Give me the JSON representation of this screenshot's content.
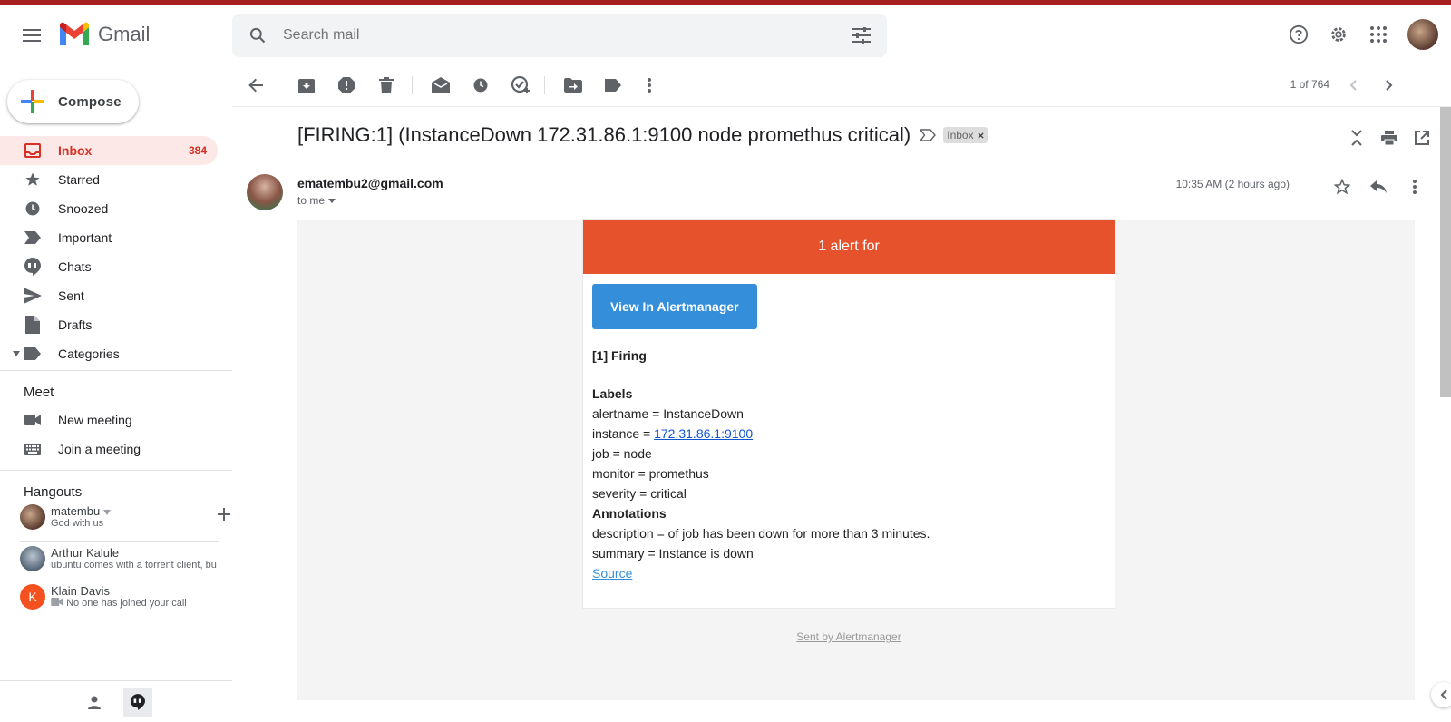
{
  "header": {
    "app_name": "Gmail",
    "search_placeholder": "Search mail"
  },
  "sidebar": {
    "compose_label": "Compose",
    "items": [
      {
        "label": "Inbox",
        "count": "384",
        "icon": "inbox-icon"
      },
      {
        "label": "Starred",
        "icon": "star-icon"
      },
      {
        "label": "Snoozed",
        "icon": "clock-icon"
      },
      {
        "label": "Important",
        "icon": "important-icon"
      },
      {
        "label": "Chats",
        "icon": "chat-icon"
      },
      {
        "label": "Sent",
        "icon": "send-icon"
      },
      {
        "label": "Drafts",
        "icon": "draft-icon"
      },
      {
        "label": "Categories",
        "icon": "label-icon"
      }
    ],
    "meet": {
      "title": "Meet",
      "new_meeting": "New meeting",
      "join_meeting": "Join a meeting"
    },
    "hangouts": {
      "title": "Hangouts",
      "me": {
        "name": "matembu",
        "status": "God with us"
      },
      "contacts": [
        {
          "name": "Arthur Kalule",
          "preview": "ubuntu comes with a torrent client, bu"
        },
        {
          "name": "Klain Davis",
          "initial": "K",
          "preview": "No one has joined your call"
        }
      ]
    }
  },
  "toolbar": {
    "pager": "1 of 764"
  },
  "message": {
    "subject": "[FIRING:1] (InstanceDown 172.31.86.1:9100 node promethus critical)",
    "label_chip": "Inbox",
    "sender": "ematembu2@gmail.com",
    "to": "to me",
    "time": "10:35 AM (2 hours ago)",
    "email": {
      "header": "1 alert for",
      "button": "View In Alertmanager",
      "firing": "[1] Firing",
      "labels_title": "Labels",
      "alertname": "alertname = InstanceDown",
      "instance_prefix": "instance = ",
      "instance_link": "172.31.86.1:9100",
      "job": "job = node",
      "monitor": "monitor = promethus",
      "severity": "severity = critical",
      "annotations_title": "Annotations",
      "description": "description = of job has been down for more than 3 minutes.",
      "summary": "summary = Instance is down",
      "source": "Source",
      "sent_by": "Sent by Alertmanager"
    }
  },
  "colors": {
    "accent_red": "#d93025",
    "alert_header": "#e6522c",
    "button_blue": "#348eda",
    "inbox_active_bg": "#fce8e6"
  }
}
